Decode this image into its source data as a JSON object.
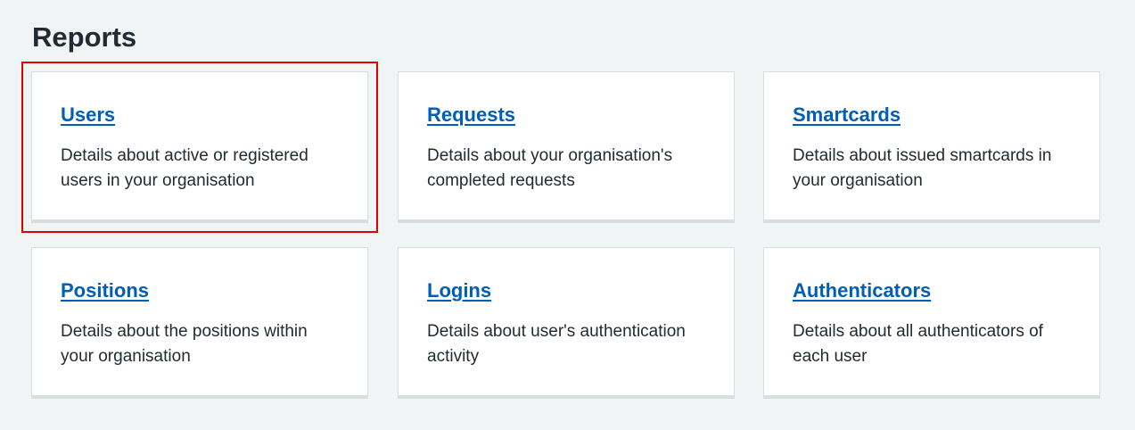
{
  "page": {
    "title": "Reports"
  },
  "cards": [
    {
      "title": "Users",
      "description": "Details about active or registered users in your organisation"
    },
    {
      "title": "Requests",
      "description": "Details about your organisation's completed requests"
    },
    {
      "title": "Smartcards",
      "description": "Details about issued smartcards in your organisation"
    },
    {
      "title": "Positions",
      "description": "Details about the positions within your organisation"
    },
    {
      "title": "Logins",
      "description": "Details about user's authentication activity"
    },
    {
      "title": "Authenticators",
      "description": "Details about all authenticators of each user"
    }
  ],
  "colors": {
    "link": "#005eb8",
    "text": "#212b32",
    "background": "#f0f4f5",
    "card_border": "#d8dde0",
    "highlight": "#e00000"
  }
}
